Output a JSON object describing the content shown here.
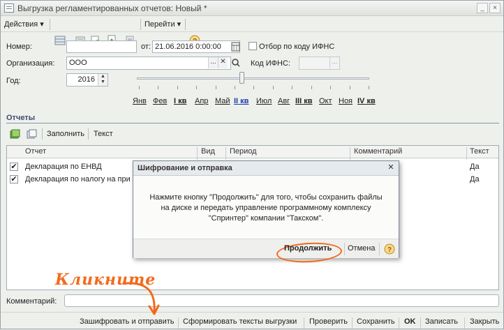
{
  "window": {
    "title": "Выгрузка регламентированных отчетов: Новый *"
  },
  "toolbar": {
    "actions": "Действия",
    "goto": "Перейти"
  },
  "form": {
    "number_label": "Номер:",
    "number_value": "",
    "from_label": "от:",
    "date_value": "21.06.2016  0:00:00",
    "filter_label": "Отбор по коду ИФНС",
    "org_label": "Организация:",
    "org_value": "ООО",
    "ifns_label": "Код ИФНС:",
    "year_label": "Год:",
    "year_value": "2016"
  },
  "periods": [
    "Янв",
    "Фев",
    "I кв",
    "Апр",
    "Май",
    "II кв",
    "Июл",
    "Авг",
    "III кв",
    "Окт",
    "Ноя",
    "IV кв"
  ],
  "reports": {
    "title": "Отчеты",
    "fill_button": "Заполнить",
    "text_button": "Текст",
    "columns": [
      "Отчет",
      "Вид",
      "Период",
      "Комментарий",
      "Текст"
    ],
    "rows": [
      {
        "name": "Декларация по ЕНВД",
        "text": "Да",
        "checked": true
      },
      {
        "name": "Декларация по налогу на при",
        "text": "Да",
        "checked": true
      }
    ]
  },
  "dialog": {
    "title": "Шифрование и отправка",
    "message": [
      "Нажмите кнопку \"Продолжить\" для того, чтобы сохранить файлы",
      "на диске и передать управление программному комплексу",
      "\"Спринтер\" компании \"Такском\"."
    ],
    "continue": "Продолжить",
    "cancel": "Отмена"
  },
  "annotation": {
    "text": "Кликните",
    "color": "#f26a1b"
  },
  "comment": {
    "label": "Комментарий:",
    "value": ""
  },
  "bottom": {
    "encrypt_send": "Зашифровать и отправить",
    "generate": "Сформировать тексты выгрузки",
    "check": "Проверить",
    "save": "Сохранить",
    "ok": "OK",
    "write": "Записать",
    "close": "Закрыть"
  }
}
